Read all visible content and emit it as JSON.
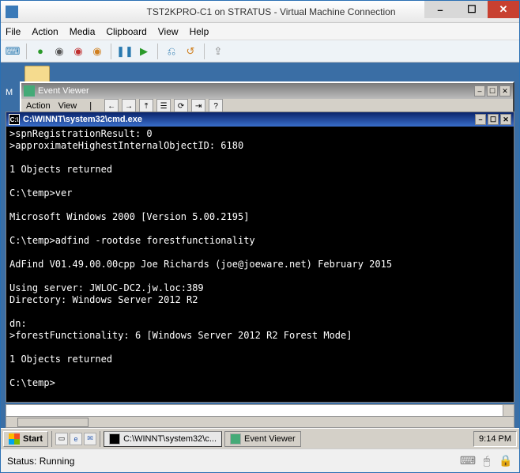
{
  "vm": {
    "title": "TST2KPRO-C1 on STRATUS - Virtual Machine Connection",
    "menu": {
      "file": "File",
      "action": "Action",
      "media": "Media",
      "clipboard": "Clipboard",
      "view": "View",
      "help": "Help"
    },
    "status": "Status: Running"
  },
  "eventviewer": {
    "title": "Event Viewer",
    "menu": {
      "action": "Action",
      "view": "View"
    }
  },
  "cmd": {
    "title": "C:\\WINNT\\system32\\cmd.exe",
    "lines": [
      ">spnRegistrationResult: 0",
      ">approximateHighestInternalObjectID: 6180",
      "",
      "1 Objects returned",
      "",
      "C:\\temp>ver",
      "",
      "Microsoft Windows 2000 [Version 5.00.2195]",
      "",
      "C:\\temp>adfind -rootdse forestfunctionality",
      "",
      "AdFind V01.49.00.00cpp Joe Richards (joe@joeware.net) February 2015",
      "",
      "Using server: JWLOC-DC2.jw.loc:389",
      "Directory: Windows Server 2012 R2",
      "",
      "dn:",
      ">forestFunctionality: 6 [Windows Server 2012 R2 Forest Mode]",
      "",
      "1 Objects returned",
      "",
      "C:\\temp>"
    ]
  },
  "taskbar": {
    "start": "Start",
    "task1": "C:\\WINNT\\system32\\c...",
    "task2": "Event Viewer",
    "clock": "9:14 PM"
  },
  "glyph": {
    "min": "–",
    "max": "☐",
    "close": "✕",
    "restore": "❐"
  }
}
